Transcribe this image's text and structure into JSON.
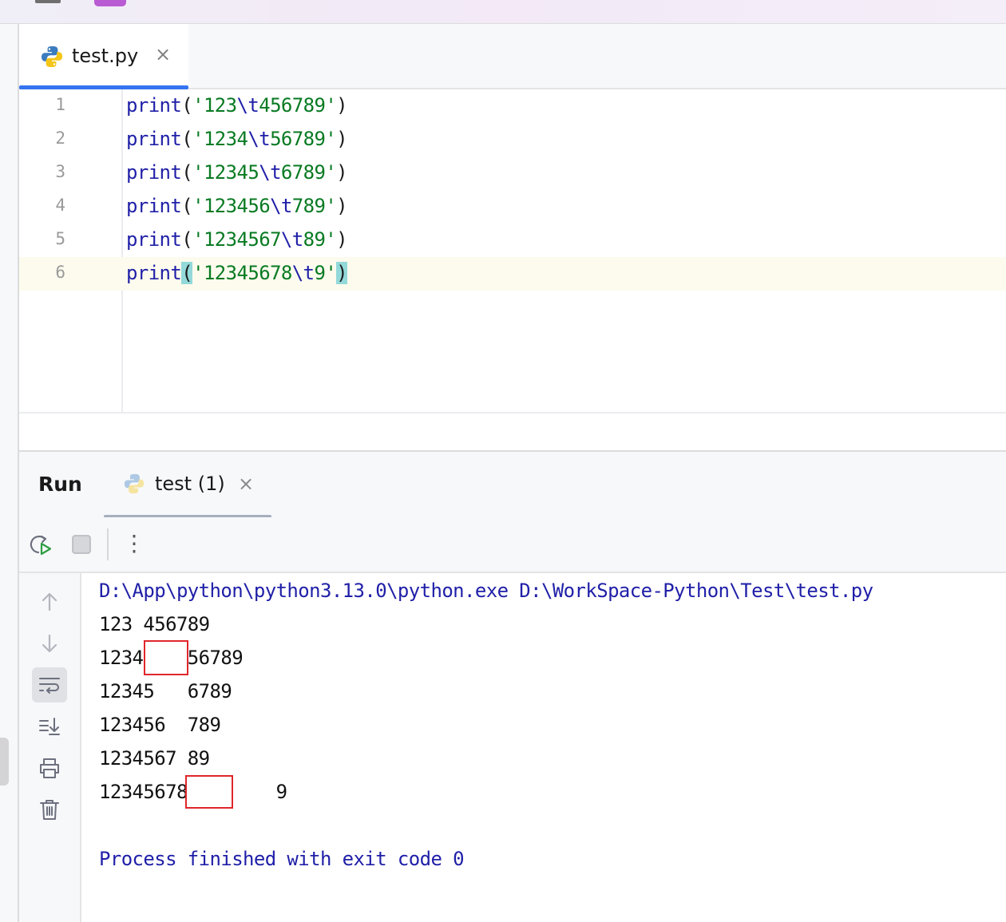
{
  "editor": {
    "tab": {
      "filename": "test.py",
      "close_glyph": "×"
    },
    "lines": [
      {
        "num": "1",
        "fn": "print",
        "open": "(",
        "str_a": "'123",
        "esc": "\\t",
        "str_b": "456789'",
        "close": ")"
      },
      {
        "num": "2",
        "fn": "print",
        "open": "(",
        "str_a": "'1234",
        "esc": "\\t",
        "str_b": "56789'",
        "close": ")"
      },
      {
        "num": "3",
        "fn": "print",
        "open": "(",
        "str_a": "'12345",
        "esc": "\\t",
        "str_b": "6789'",
        "close": ")"
      },
      {
        "num": "4",
        "fn": "print",
        "open": "(",
        "str_a": "'123456",
        "esc": "\\t",
        "str_b": "789'",
        "close": ")"
      },
      {
        "num": "5",
        "fn": "print",
        "open": "(",
        "str_a": "'1234567",
        "esc": "\\t",
        "str_b": "89'",
        "close": ")"
      },
      {
        "num": "6",
        "fn": "print",
        "open": "(",
        "str_a": "'12345678",
        "esc": "\\t",
        "str_b": "9'",
        "close": ")"
      }
    ]
  },
  "run": {
    "title": "Run",
    "tab": {
      "label": "test (1)",
      "close_glyph": "×"
    },
    "toolbar": {
      "more_glyph": "⋮"
    },
    "console": {
      "command": "D:\\App\\python\\python3.13.0\\python.exe D:\\WorkSpace-Python\\Test\\test.py",
      "output": [
        "123 456789",
        "1234    56789",
        "12345   6789",
        "123456  789",
        "1234567 89",
        "12345678        9"
      ],
      "footer": "Process finished with exit code 0"
    }
  },
  "colors": {
    "keyword": "#1f1fa8",
    "string": "#087a22",
    "bracket_match": "#93d9d9",
    "tab_underline_active": "#3574f0",
    "highlight_box": "#e0262b"
  },
  "icons": {
    "file_type": "python-icon",
    "rerun": "rerun-icon",
    "stop": "stop-icon",
    "scroll_up": "arrow-up-icon",
    "scroll_down": "arrow-down-icon",
    "soft_wrap": "soft-wrap-icon",
    "scroll_to_end": "scroll-to-end-icon",
    "print": "printer-icon",
    "clear": "trash-icon"
  }
}
